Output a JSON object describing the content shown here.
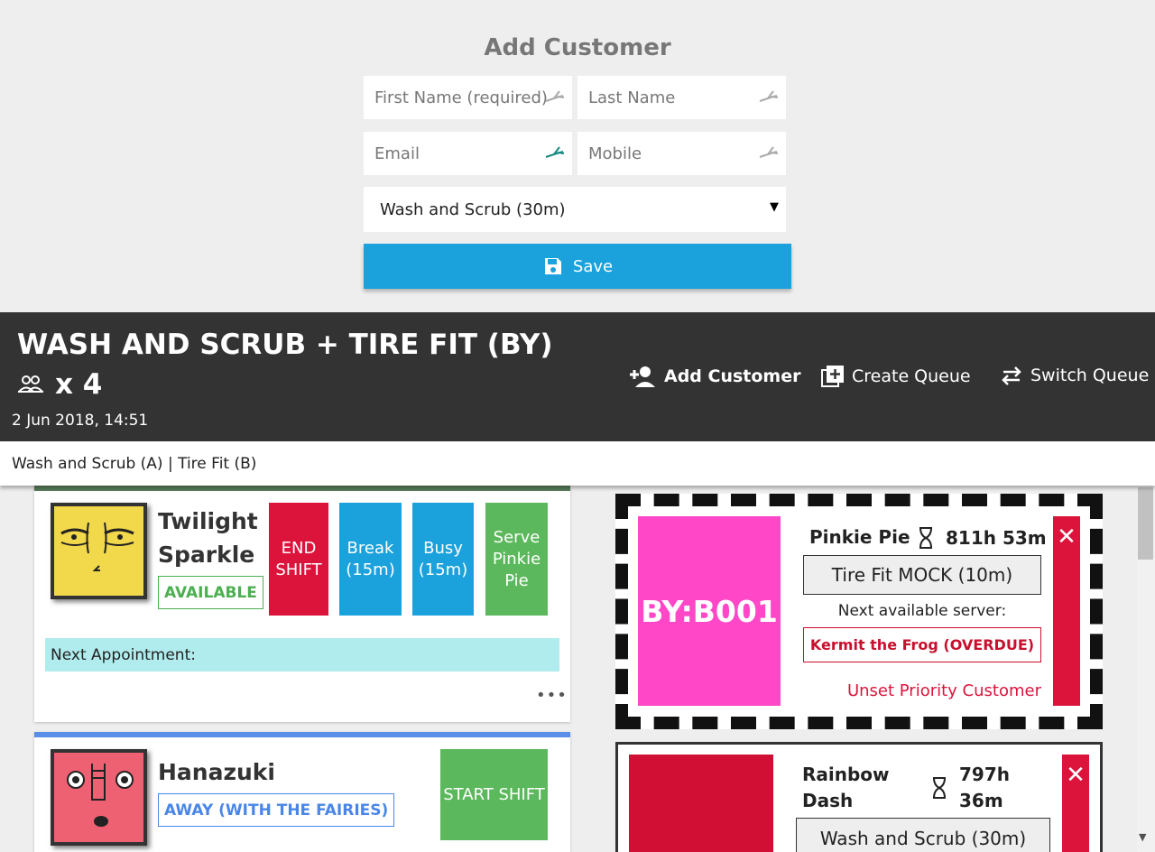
{
  "form": {
    "title": "Add Customer",
    "first_name_placeholder": "First Name (required)",
    "last_name_placeholder": "Last Name",
    "email_placeholder": "Email",
    "mobile_placeholder": "Mobile",
    "service_selected": "Wash and Scrub (30m)",
    "save_label": "Save"
  },
  "header": {
    "queue_title": "WASH AND SCRUB + TIRE FIT (BY)",
    "count_label": "x 4",
    "datetime": "2 Jun 2018, 14:51",
    "add_customer_label": "Add Customer",
    "create_queue_label": "Create Queue",
    "switch_queue_label": "Switch Queue"
  },
  "subheader": {
    "services": "Wash and Scrub (A) | Tire Fit (B)"
  },
  "servers": [
    {
      "name_line1": "Twilight",
      "name_line2": "Sparkle",
      "status": "AVAILABLE",
      "buttons": {
        "end_shift": "END SHIFT",
        "break": "Break (15m)",
        "busy": "Busy (15m)",
        "serve": "Serve Pinkie Pie"
      },
      "next_appointment_label": "Next Appointment:",
      "more": "•••"
    },
    {
      "name": "Hanazuki",
      "status": "AWAY (WITH THE FAIRIES)",
      "start_shift": "START SHIFT"
    }
  ],
  "tickets": [
    {
      "code": "BY:B001",
      "customer": "Pinkie Pie",
      "wait": "811h 53m",
      "service": "Tire Fit MOCK (10m)",
      "next_server_label": "Next available server:",
      "next_server": "Kermit the Frog (OVERDUE)",
      "priority_action": "Unset Priority Customer",
      "close": "✕"
    },
    {
      "customer_line1": "Rainbow",
      "customer_line2": "Dash",
      "wait_line1": "797h",
      "wait_line2": "36m",
      "service": "Wash and Scrub (30m)",
      "close": "✕"
    }
  ],
  "colors": {
    "save": "#1ba2dc",
    "header_bg": "#333333",
    "end_shift": "#dc143c",
    "break": "#1ba2dc",
    "serve": "#5cb85c",
    "available": "#4caf50",
    "away": "#4a86e8",
    "ticket_code": "#ff47c7",
    "overdue": "#c8102e"
  },
  "icons": {
    "autofill": "autofill-key-icon",
    "save": "floppy-disk-icon",
    "people": "people-icon",
    "add_person": "person-add-icon",
    "create_queue": "library-add-icon",
    "switch_queue": "swap-arrows-icon",
    "hourglass": "hourglass-icon"
  }
}
